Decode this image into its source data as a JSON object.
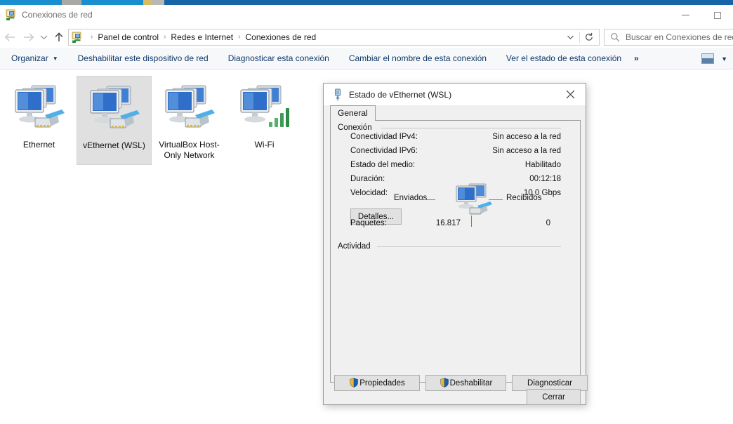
{
  "window": {
    "title": "Conexiones de red",
    "title_icon": "network-connections-icon",
    "minimize_label": "Minimizar",
    "maximize_label": "Maximizar"
  },
  "nav": {
    "back_icon": "arrow-left-icon",
    "forward_icon": "arrow-right-icon",
    "history_icon": "chevron-down-icon",
    "up_icon": "arrow-up-icon",
    "breadcrumbs": [
      "Panel de control",
      "Redes e Internet",
      "Conexiones de red"
    ],
    "separator": "›",
    "dropdown_icon": "chevron-down-icon",
    "refresh_icon": "refresh-icon"
  },
  "search": {
    "placeholder": "Buscar en Conexiones de red",
    "icon": "search-icon"
  },
  "toolbar": {
    "organize_label": "Organizar",
    "items": [
      "Deshabilitar este dispositivo de red",
      "Diagnosticar esta conexión",
      "Cambiar el nombre de esta conexión",
      "Ver el estado de esta conexión"
    ],
    "overflow_label": "»",
    "view_icon": "view-layout-icon",
    "view_caret": "▼"
  },
  "connections": [
    {
      "name": "Ethernet",
      "icon": "network-adapter-icon",
      "selected": false,
      "wireless": false
    },
    {
      "name": "vEthernet (WSL)",
      "icon": "network-adapter-icon",
      "selected": true,
      "wireless": false
    },
    {
      "name": "VirtualBox Host-Only Network",
      "icon": "network-adapter-icon",
      "selected": false,
      "wireless": false
    },
    {
      "name": "Wi-Fi",
      "icon": "wireless-adapter-icon",
      "selected": false,
      "wireless": true
    }
  ],
  "dialog": {
    "title": "Estado de vEthernet (WSL)",
    "title_icon": "network-cable-icon",
    "close_icon": "close-icon",
    "tab": "General",
    "connection": {
      "group_label": "Conexión",
      "rows": [
        {
          "key": "Conectividad IPv4:",
          "value": "Sin acceso a la red"
        },
        {
          "key": "Conectividad IPv6:",
          "value": "Sin acceso a la red"
        },
        {
          "key": "Estado del medio:",
          "value": "Habilitado"
        },
        {
          "key": "Duración:",
          "value": "00:12:18"
        },
        {
          "key": "Velocidad:",
          "value": "10,0 Gbps"
        }
      ],
      "details_button": "Detalles..."
    },
    "activity": {
      "group_label": "Actividad",
      "sent_label": "Enviados",
      "received_label": "Recibidos",
      "packets_label": "Paquetes:",
      "packets_sent": "16.817",
      "packets_received": "0",
      "icon": "computer-network-activity-icon"
    },
    "buttons": {
      "properties": "Propiedades",
      "disable": "Deshabilitar",
      "diagnose": "Diagnosticar",
      "close": "Cerrar",
      "shield_icon": "uac-shield-icon"
    }
  },
  "colors": {
    "accent": "#1565a8",
    "link": "#10396b",
    "toolbar_bg": "#f7f8fa",
    "dialog_bg": "#f0f0f0",
    "selection": "#e0e0e0"
  }
}
